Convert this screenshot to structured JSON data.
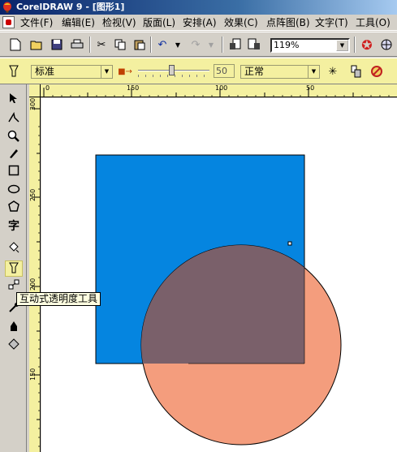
{
  "window": {
    "title": "CorelDRAW 9 - [图形1]"
  },
  "menu": [
    {
      "label": "文件(F)"
    },
    {
      "label": "编辑(E)"
    },
    {
      "label": "检视(V)"
    },
    {
      "label": "版面(L)"
    },
    {
      "label": "安排(A)"
    },
    {
      "label": "效果(C)"
    },
    {
      "label": "点阵图(B)"
    },
    {
      "label": "文字(T)"
    },
    {
      "label": "工具(O)"
    }
  ],
  "toolbar": {
    "zoom": "119%"
  },
  "property_bar": {
    "transparency_type": "标准",
    "amount": "50",
    "operation": "正常"
  },
  "rulers": {
    "horizontal": [
      "0",
      "150",
      "100",
      "50"
    ],
    "vertical": [
      "300",
      "250",
      "200",
      "150"
    ]
  },
  "tooltip": "互动式透明度工具",
  "colors": {
    "rectangle_fill": "#0585e0",
    "circle_fill": "#f49d7d",
    "overlap_fill": "#7a606a",
    "property_bar_bg": "#f4f0a0"
  }
}
